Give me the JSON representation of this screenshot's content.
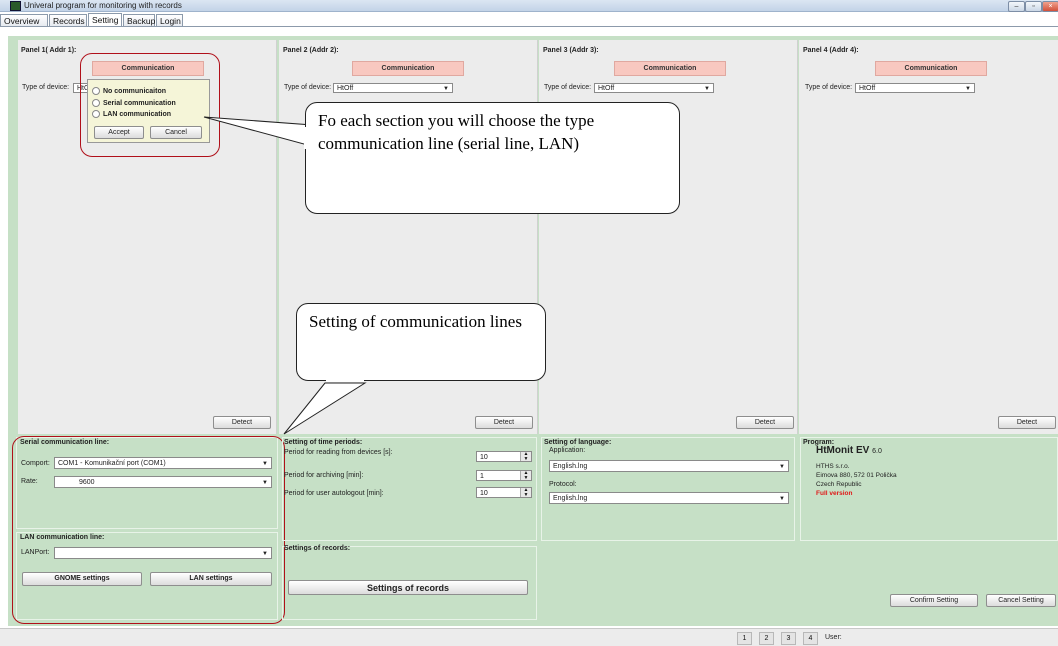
{
  "window": {
    "title": "Univeral program for monitoring with records",
    "minimize_glyph": "–",
    "restore_glyph": "▫",
    "close_glyph": "×"
  },
  "tabs": [
    "Overview",
    "Records",
    "Setting",
    "Backup",
    "Login"
  ],
  "active_tab": "Setting",
  "panels": [
    {
      "title": "Panel 1( Addr 1):",
      "button": "Communication",
      "type_label": "Type of device:",
      "device": "HtO",
      "detect": "Detect"
    },
    {
      "title": "Panel 2 (Addr 2):",
      "button": "Communication",
      "type_label": "Type of device:",
      "device": "HtOff",
      "detect": "Detect"
    },
    {
      "title": "Panel 3 (Addr 3):",
      "button": "Communication",
      "type_label": "Type of device:",
      "device": "HtOff",
      "detect": "Detect"
    },
    {
      "title": "Panel 4 (Addr 4):",
      "button": "Communication",
      "type_label": "Type of device:",
      "device": "HtOff",
      "detect": "Detect"
    }
  ],
  "comm_popup": {
    "options": [
      "No communicaiton",
      "Serial communication",
      "LAN communication"
    ],
    "accept": "Accept",
    "cancel": "Cancel"
  },
  "callouts": {
    "top": "Fo each section you will choose the type communication line (serial line, LAN)",
    "bottom": "Setting of communication lines"
  },
  "serial": {
    "title": "Serial communication line:",
    "comport_label": "Comport:",
    "comport_value": "COM1 - Komunikační port (COM1)",
    "rate_label": "Rate:",
    "rate_value": "9600"
  },
  "lan": {
    "title": "LAN communication line:",
    "port_label": "LANPort:",
    "port_value": "",
    "gnome_button": "GNOME settings",
    "lan_button": "LAN settings"
  },
  "time_periods": {
    "title": "Setting of time periods:",
    "reading_label": "Period for reading from devices [s]:",
    "reading_value": "10",
    "archiving_label": "Period for archiving [min]:",
    "archiving_value": "1",
    "autologout_label": "Period for user autologout [min]:",
    "autologout_value": "10"
  },
  "records": {
    "title": "Settings of records:",
    "button": "Settings of records"
  },
  "language": {
    "title": "Setting of language:",
    "application_label": "Application:",
    "application_value": "English.lng",
    "protocol_label": "Protocol:",
    "protocol_value": "English.lng"
  },
  "program": {
    "title": "Program:",
    "name": "HtMonit EV",
    "version": "6.0",
    "company": "HTHS s.r.o.",
    "address": "Eimova 880, 572 01 Polička",
    "country": "Czech Republic",
    "license": "Full version"
  },
  "actions": {
    "confirm": "Confirm Setting",
    "cancel": "Cancel Setting"
  },
  "statusbar": {
    "pages": [
      "1",
      "2",
      "3",
      "4"
    ],
    "user_label": "User:"
  },
  "colors": {
    "background_green": "#c6e0c6",
    "communication_button": "#f8c8c0",
    "highlight_red": "#b0101a",
    "license_red": "#e01818"
  }
}
